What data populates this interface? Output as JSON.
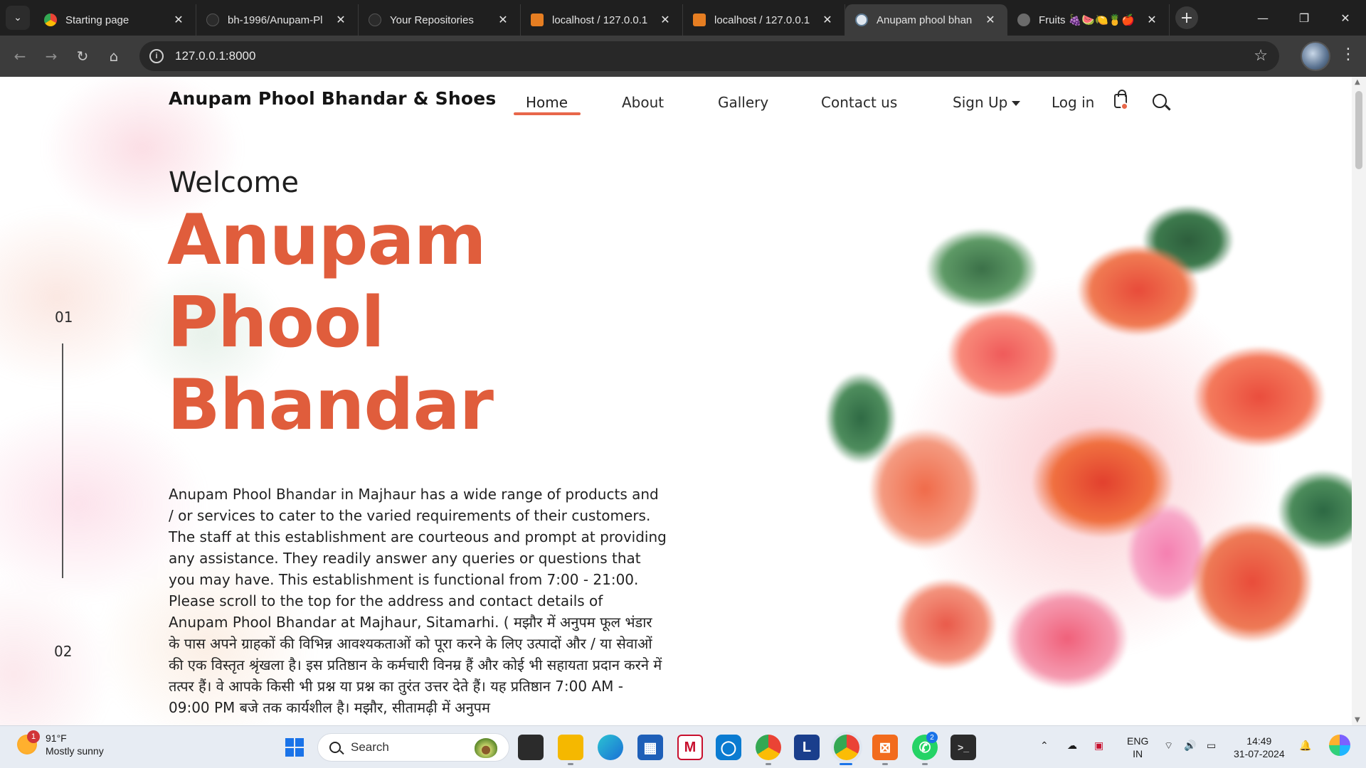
{
  "browser": {
    "tabs": [
      {
        "title": "Starting page",
        "favicon_color": "#4285f4"
      },
      {
        "title": "bh-1996/Anupam-Pl",
        "favicon_color": "#2b2b2b"
      },
      {
        "title": "Your Repositories",
        "favicon_color": "#2b2b2b"
      },
      {
        "title": "localhost / 127.0.0.1",
        "favicon_color": "#e67e22"
      },
      {
        "title": "localhost / 127.0.0.1",
        "favicon_color": "#e67e22"
      },
      {
        "title": "Anupam phool bhan",
        "favicon_color": "#5c7891"
      },
      {
        "title": "Fruits 🍇🍉🍋🍍🍎",
        "favicon_color": "#6b6b6b"
      }
    ],
    "active_tab_index": 5,
    "url": "127.0.0.1:8000"
  },
  "site": {
    "brand": "Anupam Phool Bhandar & Shoes",
    "nav": {
      "home": "Home",
      "about": "About",
      "gallery": "Gallery",
      "contact": "Contact us",
      "signup": "Sign Up",
      "login": "Log in"
    },
    "accent": "#e05d3c"
  },
  "hero": {
    "welcome": "Welcome",
    "title_lines": [
      "Anupam",
      "Phool",
      "Bhandar"
    ],
    "slide_start": "01",
    "slide_end": "02",
    "description": "Anupam Phool Bhandar in Majhaur has a wide range of products and / or services to cater to the varied requirements of their customers. The staff at this establishment are courteous and prompt at providing any assistance. They readily answer any queries or questions that you may have. This establishment is functional from 7:00 - 21:00. Please scroll to the top for the address and contact details of Anupam Phool Bhandar at Majhaur, Sitamarhi. ( मझौर में अनुपम फूल भंडार के पास अपने ग्राहकों की विभिन्न आवश्यकताओं को पूरा करने के लिए उत्पादों और / या सेवाओं की एक विस्तृत श्रृंखला है। इस प्रतिष्ठान के कर्मचारी विनम्र हैं और कोई भी सहायता प्रदान करने में तत्पर हैं। वे आपके किसी भी प्रश्न या प्रश्न का तुरंत उत्तर देते हैं। यह प्रतिष्ठान 7:00 AM - 09:00 PM बजे तक कार्यशील है। मझौर, सीतामढ़ी में अनुपम"
  },
  "taskbar": {
    "weather_temp": "91°F",
    "weather_desc": "Mostly sunny",
    "weather_badge": "1",
    "search_placeholder": "Search",
    "whatsapp_badge": "2",
    "chrome_badge": "",
    "lang_top": "ENG",
    "lang_bottom": "IN",
    "time": "14:49",
    "date": "31-07-2024"
  }
}
